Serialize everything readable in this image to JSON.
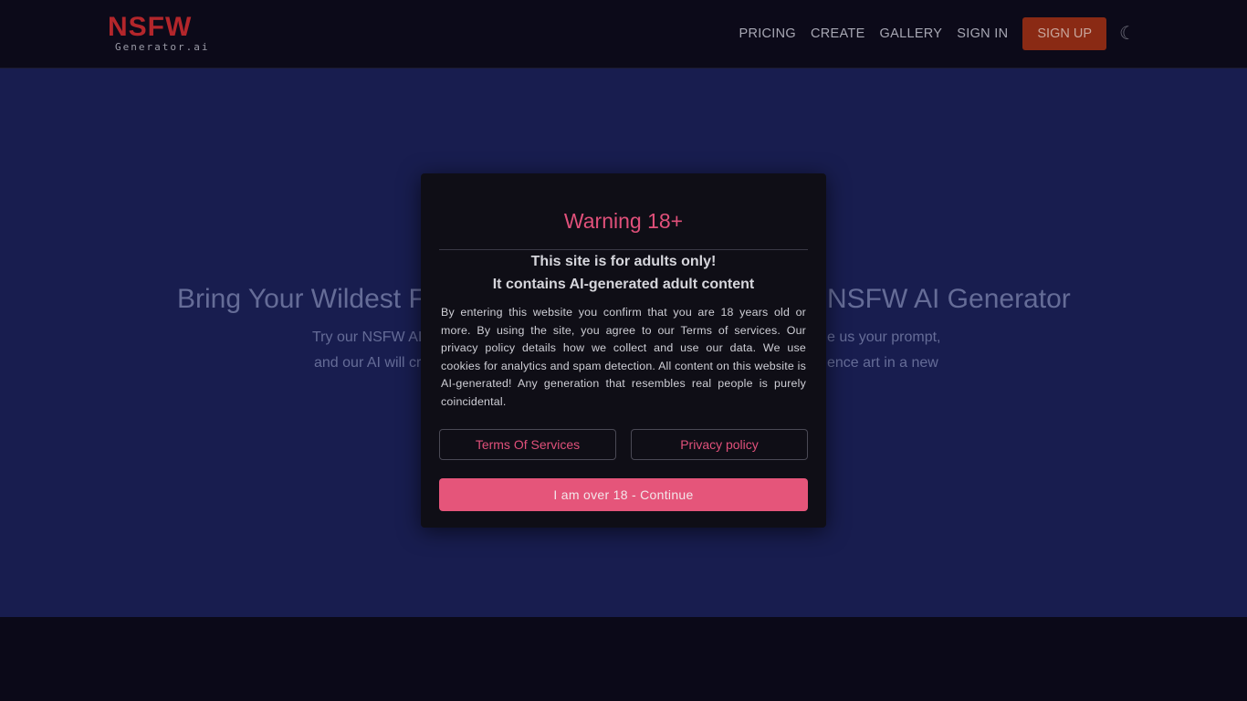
{
  "nav": {
    "logo_text": "NSFW",
    "logo_sub": "Generator.ai",
    "items": [
      "PRICING",
      "CREATE",
      "GALLERY",
      "SIGN IN"
    ],
    "signup": "SIGN UP",
    "theme_icon": "moon-icon"
  },
  "hero": {
    "title_left": "Bring Your Wildest F",
    "title_right": "NSFW AI Generator",
    "line1_left": "Try our NSFW AI",
    "line1_right": "e us your prompt,",
    "line2_left": "and our AI will cr",
    "line2_right": "ence art in a new"
  },
  "modal": {
    "title": "Warning 18+",
    "sub1": "This site is for adults only!",
    "sub2": "It contains AI-generated adult content",
    "body": "By entering this website you confirm that you are 18 years old or more. By using the site, you agree to our Terms of services. Our privacy policy details how we collect and use our data. We use cookies for analytics and spam detection. All content on this website is AI-generated! Any generation that resembles real people is purely coincidental.",
    "terms": "Terms Of Services",
    "privacy": "Privacy policy",
    "continue": "I am over 18 - Continue"
  },
  "colors": {
    "accent": "#e5557a",
    "signup": "#8a2a14",
    "hero_bg": "#181d4f"
  }
}
